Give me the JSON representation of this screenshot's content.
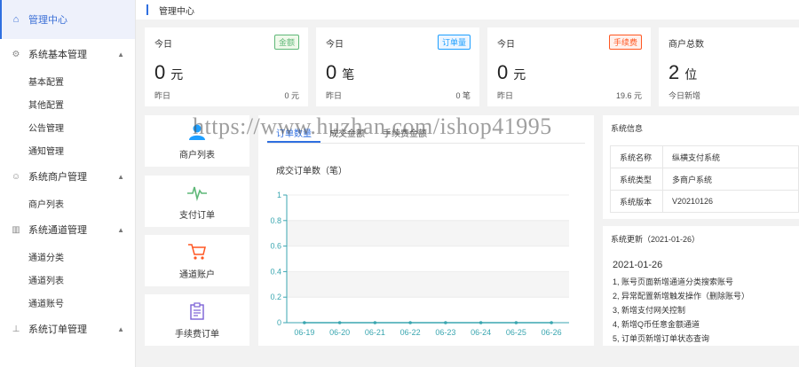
{
  "sidebar": {
    "home": {
      "label": "管理中心",
      "icon": "home-icon"
    },
    "groups": [
      {
        "label": "系统基本管理",
        "icon": "gear-icon",
        "items": [
          {
            "label": "基本配置"
          },
          {
            "label": "其他配置"
          },
          {
            "label": "公告管理"
          },
          {
            "label": "通知管理"
          }
        ]
      },
      {
        "label": "系统商户管理",
        "icon": "user-icon",
        "items": [
          {
            "label": "商户列表"
          }
        ]
      },
      {
        "label": "系统通道管理",
        "icon": "grid-icon",
        "items": [
          {
            "label": "通道分类"
          },
          {
            "label": "通道列表"
          },
          {
            "label": "通道账号"
          }
        ]
      },
      {
        "label": "系统订单管理",
        "icon": "order-icon",
        "items": []
      }
    ]
  },
  "header": {
    "breadcrumb": "管理中心"
  },
  "stats": [
    {
      "label": "今日",
      "badge": "金额",
      "badge_color": "#5fb878",
      "value": "0",
      "unit": "元",
      "foot_left": "昨日",
      "foot_right": "0 元"
    },
    {
      "label": "今日",
      "badge": "订单量",
      "badge_color": "#1e9fff",
      "value": "0",
      "unit": "笔",
      "foot_left": "昨日",
      "foot_right": "0 笔"
    },
    {
      "label": "今日",
      "badge": "手续费",
      "badge_color": "#ff5722",
      "value": "0",
      "unit": "元",
      "foot_left": "昨日",
      "foot_right": "19.6 元"
    },
    {
      "label": "商户总数",
      "badge": "",
      "badge_color": "",
      "value": "2",
      "unit": "位",
      "foot_left": "今日新增",
      "foot_right": ""
    }
  ],
  "shortcuts": [
    {
      "label": "商户列表",
      "icon": "users-icon",
      "color": "#1e9fff"
    },
    {
      "label": "支付订单",
      "icon": "pulse-icon",
      "color": "#5fb878"
    },
    {
      "label": "通道账户",
      "icon": "cart-icon",
      "color": "#ff5722"
    },
    {
      "label": "手续费订单",
      "icon": "clipboard-icon",
      "color": "#7b61d6"
    }
  ],
  "chart_tabs": [
    {
      "label": "订单数量"
    },
    {
      "label": "成交金额"
    },
    {
      "label": "手续费金额"
    }
  ],
  "chart_data": {
    "type": "line",
    "title": "成交订单数（笔）",
    "categories": [
      "06-19",
      "06-20",
      "06-21",
      "06-22",
      "06-23",
      "06-24",
      "06-25",
      "06-26"
    ],
    "values": [
      0,
      0,
      0,
      0,
      0,
      0,
      0,
      0
    ],
    "ylim": [
      0,
      1
    ],
    "yticks": [
      "0",
      "0.2",
      "0.4",
      "0.6",
      "0.8",
      "1"
    ],
    "line_color": "#3aa6b0"
  },
  "info": {
    "title": "系统信息",
    "rows": [
      {
        "k": "系统名称",
        "v": "纵横支付系统"
      },
      {
        "k": "系统类型",
        "v": "多商户系统"
      },
      {
        "k": "系统版本",
        "v": "V20210126"
      }
    ]
  },
  "update": {
    "title": "系统更新（2021-01-26）",
    "date": "2021-01-26",
    "items": [
      "1, 账号页面新增通道分类搜索账号",
      "2, 异常配置新增触发操作（删除账号）",
      "3, 新增支付网关控制",
      "4, 新增Q币任意金额通道",
      "5, 订单页新增订单状态查询"
    ]
  },
  "watermark": "https://www.huzhan.com/ishop41995"
}
